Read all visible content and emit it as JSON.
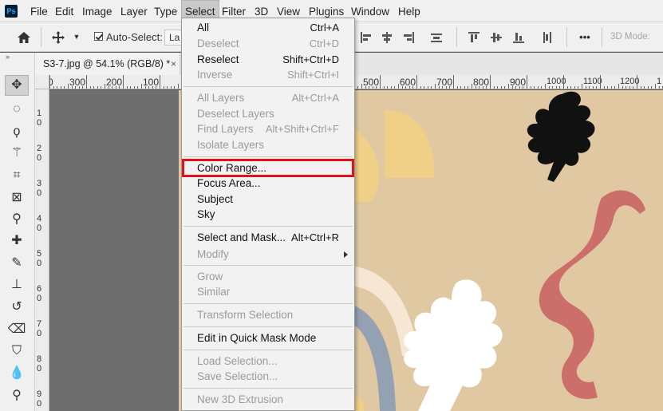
{
  "app": {
    "logo": "Ps"
  },
  "menubar": {
    "items": [
      "File",
      "Edit",
      "Image",
      "Layer",
      "Type",
      "Select",
      "Filter",
      "3D",
      "View",
      "Plugins",
      "Window",
      "Help"
    ],
    "active": "Select"
  },
  "options_bar": {
    "auto_select_label": "Auto-Select:",
    "auto_select_checked": true,
    "layer_dropdown_value": "La",
    "more_label": "•••",
    "mode3d_label": "3D Mode:"
  },
  "document_tab": {
    "title": "S3-7.jpg @ 54.1% (RGB/8) *",
    "close": "×"
  },
  "rulers": {
    "horizontal_labels": [
      "0",
      "300",
      "200",
      "100",
      "500",
      "600",
      "700",
      "800",
      "900",
      "1000",
      "1100",
      "1200",
      "1"
    ],
    "vertical_labels": [
      "1",
      "0",
      "2",
      "0",
      "3",
      "0",
      "4",
      "0",
      "5",
      "0",
      "6",
      "0",
      "7",
      "0",
      "8",
      "0",
      "9",
      "0"
    ]
  },
  "select_menu": {
    "items": [
      {
        "label": "All",
        "shortcut": "Ctrl+A",
        "enabled": true
      },
      {
        "label": "Deselect",
        "shortcut": "Ctrl+D",
        "enabled": false
      },
      {
        "label": "Reselect",
        "shortcut": "Shift+Ctrl+D",
        "enabled": true
      },
      {
        "label": "Inverse",
        "shortcut": "Shift+Ctrl+I",
        "enabled": false
      },
      {
        "label": "All Layers",
        "shortcut": "Alt+Ctrl+A",
        "enabled": false
      },
      {
        "label": "Deselect Layers",
        "shortcut": "",
        "enabled": false
      },
      {
        "label": "Find Layers",
        "shortcut": "Alt+Shift+Ctrl+F",
        "enabled": false
      },
      {
        "label": "Isolate Layers",
        "shortcut": "",
        "enabled": false
      },
      {
        "label": "Color Range...",
        "shortcut": "",
        "enabled": true,
        "highlighted": true
      },
      {
        "label": "Focus Area...",
        "shortcut": "",
        "enabled": true
      },
      {
        "label": "Subject",
        "shortcut": "",
        "enabled": true
      },
      {
        "label": "Sky",
        "shortcut": "",
        "enabled": true
      },
      {
        "label": "Select and Mask...",
        "shortcut": "Alt+Ctrl+R",
        "enabled": true
      },
      {
        "label": "Modify",
        "shortcut": "",
        "enabled": false,
        "submenu": true
      },
      {
        "label": "Grow",
        "shortcut": "",
        "enabled": false
      },
      {
        "label": "Similar",
        "shortcut": "",
        "enabled": false
      },
      {
        "label": "Transform Selection",
        "shortcut": "",
        "enabled": false
      },
      {
        "label": "Edit in Quick Mask Mode",
        "shortcut": "",
        "enabled": true
      },
      {
        "label": "Load Selection...",
        "shortcut": "",
        "enabled": false
      },
      {
        "label": "Save Selection...",
        "shortcut": "",
        "enabled": false
      },
      {
        "label": "New 3D Extrusion",
        "shortcut": "",
        "enabled": false
      }
    ]
  },
  "colors": {
    "canvas_bg": "#e0c8a2",
    "highlight": "#e0121a",
    "leaf_black": "#111111",
    "squiggle": "#cc6e6a",
    "half_moon": "#f0cf86",
    "leaf_white": "#ffffff",
    "arc_blue": "#93a1b3"
  }
}
